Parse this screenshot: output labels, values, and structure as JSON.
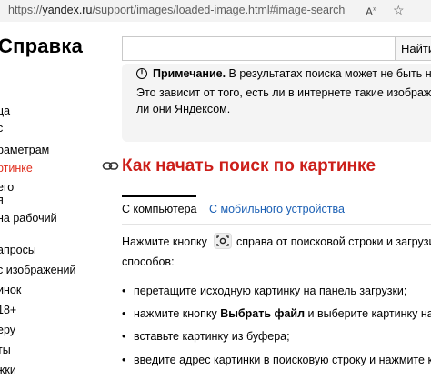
{
  "browser": {
    "url_prefix": "https://",
    "url_host": "yandex.ru",
    "url_rest": "/support/images/loaded-image.html#image-search",
    "read_aloud_icon": "read-aloud-icon",
    "favorite_icon": "star-icon"
  },
  "header": {
    "logo": "Справка",
    "search_value": "",
    "search_button": "Найти"
  },
  "sidebar": {
    "items": [
      {
        "label": "ца",
        "active": false
      },
      {
        "label": "с",
        "active": false
      },
      {
        "label": "раметрам",
        "active": false
      },
      {
        "label": "ртинке",
        "active": true
      },
      {
        "label": "его",
        "active": false
      },
      {
        "label": "я",
        "active": false
      },
      {
        "label": "на рабочий",
        "active": false
      },
      {
        "label": "апросы",
        "active": false
      },
      {
        "label": "с изображений",
        "active": false
      },
      {
        "label": "инок",
        "active": false
      },
      {
        "label": "18+",
        "active": false
      },
      {
        "label": "еру",
        "active": false
      },
      {
        "label": "ты",
        "active": false
      },
      {
        "label": "жки",
        "active": false
      }
    ]
  },
  "note": {
    "title": "Примечание.",
    "line1": " В результатах поиска может не быть ну",
    "line2": "Это зависит от того, есть ли в интернете такие изображ",
    "line3": "ли они Яндексом."
  },
  "article": {
    "heading": "Как начать поиск по картинке",
    "tabs": [
      {
        "label": "С компьютера",
        "active": true
      },
      {
        "label": "С мобильного устройства",
        "active": false
      }
    ],
    "intro_before": "Нажмите кнопку",
    "intro_after": "справа от поисковой строки и загрузи",
    "intro_line2": "способов:",
    "bullets": [
      {
        "text": "перетащите исходную картинку на панель загрузки;"
      },
      {
        "pre": "нажмите кнопку ",
        "bold": "Выбрать файл",
        "post": " и выберите картинку на н"
      },
      {
        "text": "вставьте картинку из буфера;"
      },
      {
        "text": "введите адрес картинки в поисковую строку и нажмите к"
      }
    ]
  },
  "colors": {
    "accent_red": "#cc1f1a",
    "link_blue": "#1a5fb4",
    "note_bg": "#f4f4f4"
  }
}
